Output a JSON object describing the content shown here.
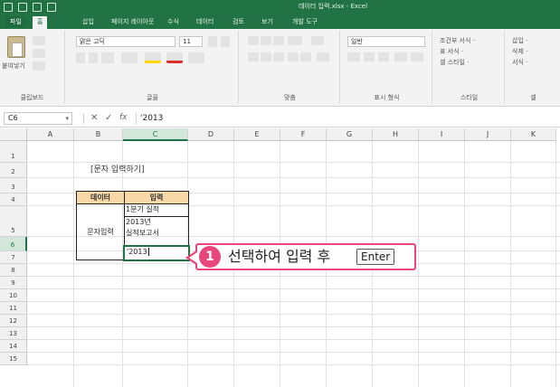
{
  "window": {
    "title": "데이터 입력.xlsx - Excel"
  },
  "ribbon": {
    "tabs": [
      "파일",
      "홈",
      "삽입",
      "페이지 레이아웃",
      "수식",
      "데이터",
      "검토",
      "보기",
      "개발 도구"
    ],
    "groups": {
      "clipboard": "클립보드",
      "font": "글꼴",
      "alignment": "맞춤",
      "number": "표시 형식",
      "styles": "스타일",
      "cells": "셀"
    },
    "font_name": "맑은 고딕",
    "font_size": "11",
    "number_format": "일반",
    "paste_label": "붙여넣기",
    "style_items": [
      "조건부 서식 ·",
      "표 서식 ·",
      "셀 스타일 ·"
    ],
    "cell_items": [
      "삽입 ·",
      "삭제 ·",
      "서식 ·"
    ]
  },
  "formula_bar": {
    "name_box": "C6",
    "cancel": "✕",
    "enter": "✓",
    "fx": "fx",
    "content": "'2013"
  },
  "sheet": {
    "columns": [
      "A",
      "B",
      "C",
      "D",
      "E",
      "F",
      "G",
      "H",
      "I",
      "J",
      "K"
    ],
    "rows": [
      "1",
      "2",
      "3",
      "4",
      "5",
      "6",
      "7",
      "8",
      "9",
      "10",
      "11",
      "12",
      "13",
      "14",
      "15"
    ],
    "selected_column": "C",
    "selected_row": "6",
    "title": "[문자 입력하기]",
    "table": {
      "header_data": "데이터",
      "header_input": "입력",
      "row_label": "문자입력",
      "c4": "1분기 실적",
      "c5_line1": "2013년",
      "c5_line2": "실적보고서",
      "c6": "'2013"
    }
  },
  "callout": {
    "step": "1",
    "text": "선택하여 입력 후",
    "key": "Enter",
    "color": "#e8467c"
  },
  "colors": {
    "excel_green": "#217346",
    "header_fill": "#f7d8a6"
  }
}
